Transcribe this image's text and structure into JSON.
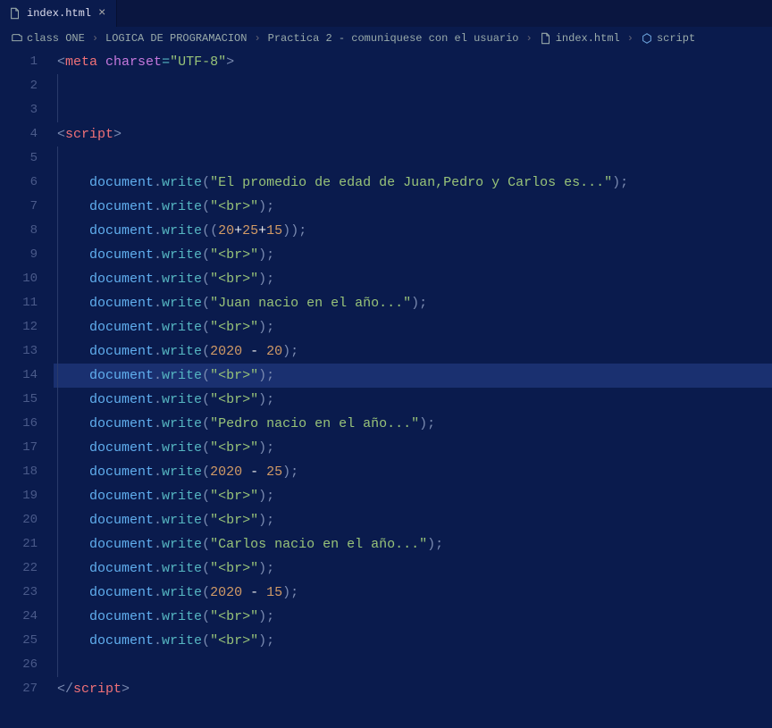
{
  "tab": {
    "filename": "index.html"
  },
  "breadcrumb": {
    "items": [
      {
        "label": "class ONE"
      },
      {
        "label": "LOGICA DE PROGRAMACION"
      },
      {
        "label": "Practica 2 - comuniquese con el usuario"
      },
      {
        "label": "index.html"
      },
      {
        "label": "script"
      }
    ]
  },
  "editor": {
    "highlightedLine": 14,
    "lineNumbers": [
      "1",
      "2",
      "3",
      "4",
      "5",
      "6",
      "7",
      "8",
      "9",
      "10",
      "11",
      "12",
      "13",
      "14",
      "15",
      "16",
      "17",
      "18",
      "19",
      "20",
      "21",
      "22",
      "23",
      "24",
      "25",
      "26",
      "27"
    ],
    "tokens": {
      "meta": "meta",
      "script": "script",
      "charset": "charset",
      "utf8": "\"UTF-8\"",
      "document": "document",
      "write": "write",
      "s_promedio": "\"El promedio de edad de Juan,Pedro y Carlos es...\"",
      "s_br": "\"<br>\"",
      "s_juan": "\"Juan nacio en el año...\"",
      "s_pedro": "\"Pedro nacio en el año...\"",
      "s_carlos": "\"Carlos nacio en el año...\"",
      "n20": "20",
      "n25": "25",
      "n15": "15",
      "n2020": "2020",
      "plus": "+",
      "minus": " - ",
      "lt": "<",
      "gt": ">",
      "ltc": "</",
      "eq": "=",
      "po": "(",
      "pc": ")",
      "dot": ".",
      "semi": ";"
    }
  }
}
